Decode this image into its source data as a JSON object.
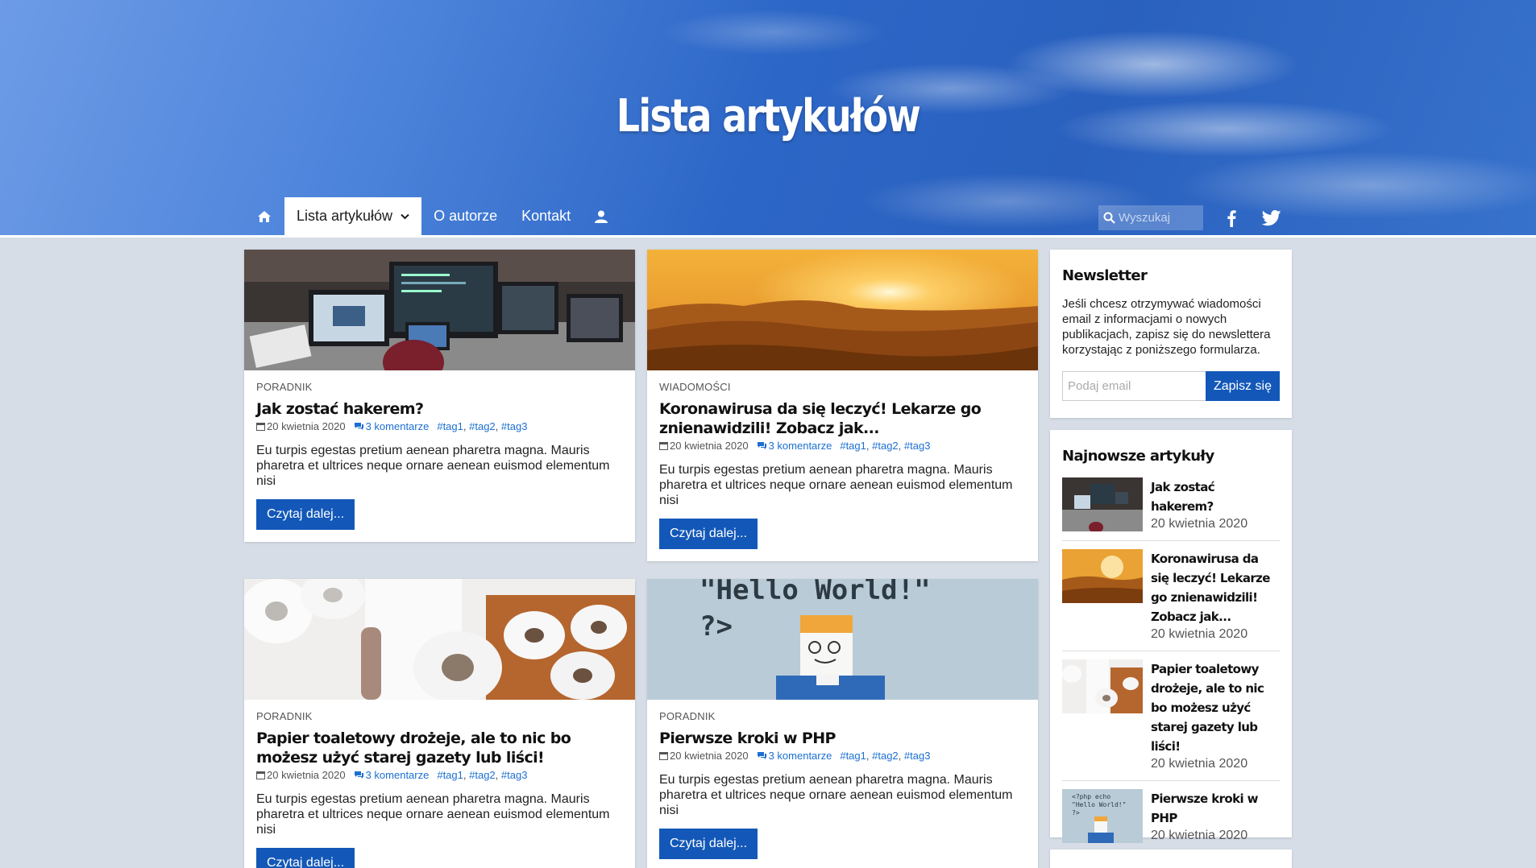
{
  "hero": {
    "title": "Lista artykułów"
  },
  "nav": {
    "items": [
      {
        "label": "Lista artykułów"
      },
      {
        "label": "O autorze"
      },
      {
        "label": "Kontakt"
      }
    ]
  },
  "search": {
    "placeholder": "Wyszukaj"
  },
  "articles": [
    {
      "category": "PORADNIK",
      "title": "Jak zostać hakerem?",
      "date": "20 kwietnia 2020",
      "comments": "3 komentarze",
      "tags": [
        "#tag1",
        "#tag2",
        "#tag3"
      ],
      "excerpt": "Eu turpis egestas pretium aenean pharetra magna. Mauris pharetra et ultrices neque ornare aenean euismod elementum nisi",
      "button": "Czytaj dalej..."
    },
    {
      "category": "WIADOMOŚCI",
      "title": "Koronawirusa da się leczyć! Lekarze go znienawidzili! Zobacz jak...",
      "date": "20 kwietnia 2020",
      "comments": "3 komentarze",
      "tags": [
        "#tag1",
        "#tag2",
        "#tag3"
      ],
      "excerpt": "Eu turpis egestas pretium aenean pharetra magna. Mauris pharetra et ultrices neque ornare aenean euismod elementum nisi",
      "button": "Czytaj dalej..."
    },
    {
      "category": "PORADNIK",
      "title": "Papier toaletowy drożeje, ale to nic bo możesz użyć starej gazety lub liści!",
      "date": "20 kwietnia 2020",
      "comments": "3 komentarze",
      "tags": [
        "#tag1",
        "#tag2",
        "#tag3"
      ],
      "excerpt": "Eu turpis egestas pretium aenean pharetra magna. Mauris pharetra et ultrices neque ornare aenean euismod elementum nisi",
      "button": "Czytaj dalej..."
    },
    {
      "category": "PORADNIK",
      "title": "Pierwsze kroki w PHP",
      "date": "20 kwietnia 2020",
      "comments": "3 komentarze",
      "tags": [
        "#tag1",
        "#tag2",
        "#tag3"
      ],
      "excerpt": "Eu turpis egestas pretium aenean pharetra magna. Mauris pharetra et ultrices neque ornare aenean euismod elementum nisi",
      "button": "Czytaj dalej..."
    }
  ],
  "newsletter": {
    "title": "Newsletter",
    "text": "Jeśli chcesz otrzymywać wiadomości email z informacjami o nowych publikacjach, zapisz się do newslettera korzystając z poniższego formularza.",
    "placeholder": "Podaj email",
    "button": "Zapisz się"
  },
  "recent": {
    "title": "Najnowsze artykuły",
    "items": [
      {
        "title": "Jak zostać hakerem?",
        "date": "20 kwietnia 2020"
      },
      {
        "title": "Koronawirusa da się leczyć! Lekarze go znienawidzili! Zobacz jak...",
        "date": "20 kwietnia 2020"
      },
      {
        "title": "Papier toaletowy drożeje, ale to nic bo możesz użyć starej gazety lub liści!",
        "date": "20 kwietnia 2020"
      },
      {
        "title": "Pierwsze kroki w PHP",
        "date": "20 kwietnia 2020"
      }
    ]
  },
  "images": {
    "php_code_line1": "<?php echo",
    "php_code_line2": "\"Hello World!\"",
    "php_code_line3": "?>"
  },
  "colors": {
    "accent": "#1358b8",
    "link": "#1b6fd1",
    "page_bg": "#d6dde6"
  }
}
